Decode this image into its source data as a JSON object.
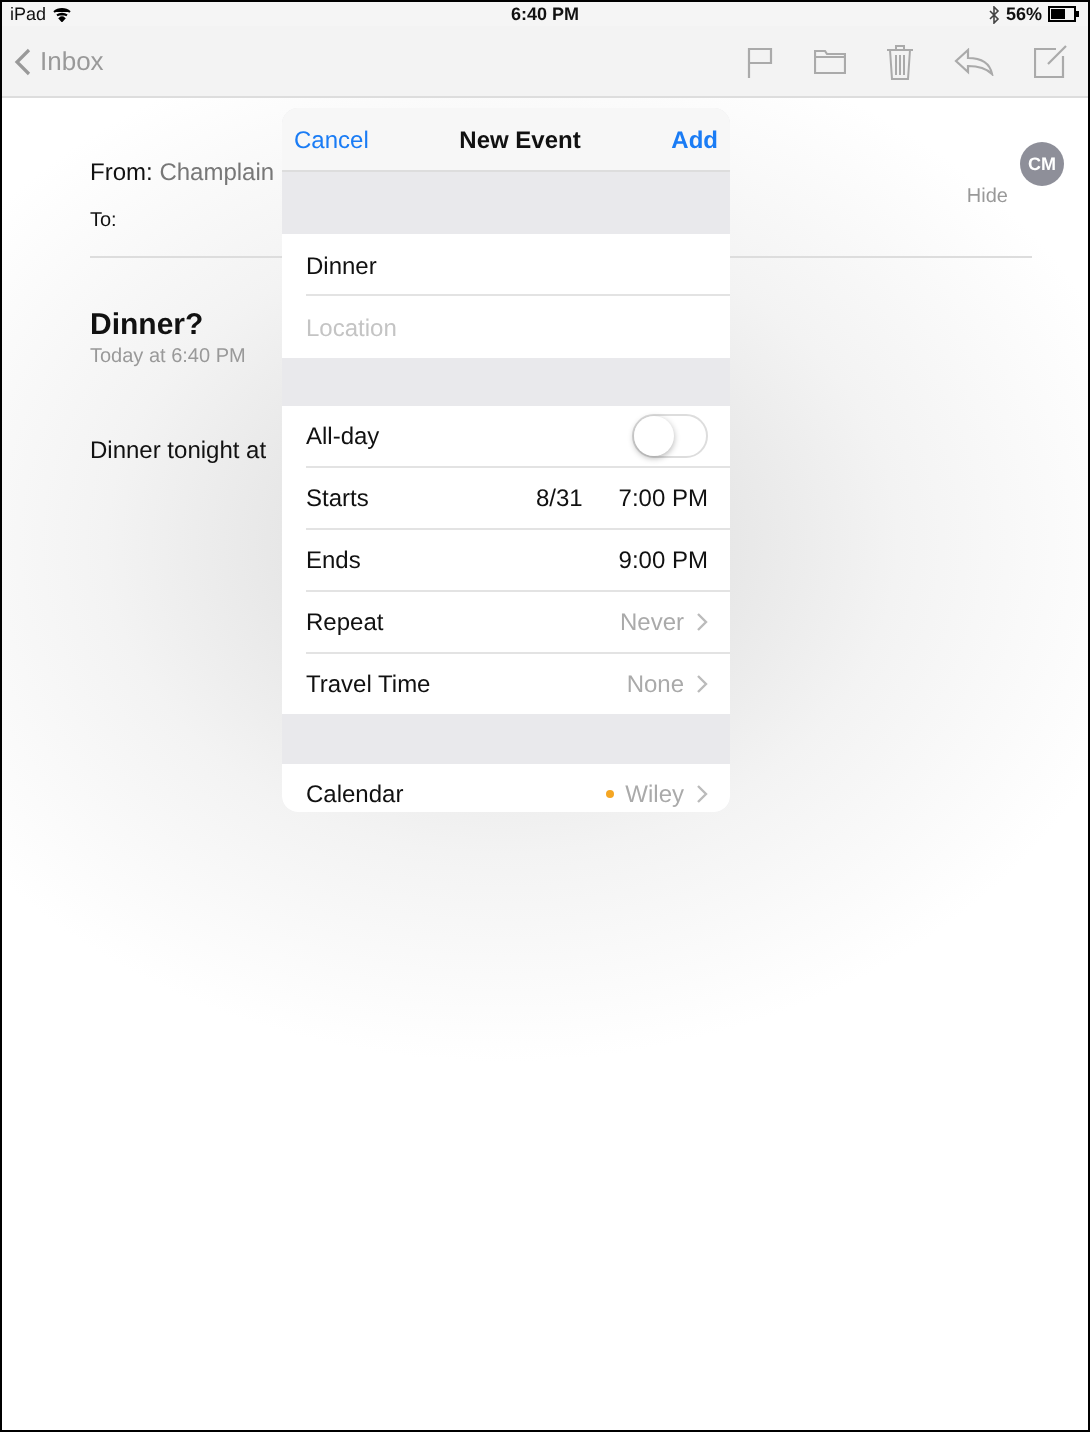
{
  "status_bar": {
    "device": "iPad",
    "time": "6:40 PM",
    "battery": "56%"
  },
  "nav_bar": {
    "back": "Inbox"
  },
  "message": {
    "from_label": "From:",
    "from": "Champlain",
    "to_label": "To:",
    "hide": "Hide",
    "avatar": "CM",
    "subject": "Dinner?",
    "date": "Today at 6:40 PM",
    "body": "Dinner tonight at"
  },
  "popover": {
    "cancel": "Cancel",
    "title": "New Event",
    "add": "Add",
    "title_field": {
      "value": "Dinner"
    },
    "location_field": {
      "placeholder": "Location"
    },
    "rows": [
      {
        "kind": "toggle",
        "label": "All-day",
        "on": false
      },
      {
        "kind": "value",
        "label": "Starts",
        "date": "8/31",
        "value": "7:00 PM"
      },
      {
        "kind": "value",
        "label": "Ends",
        "value": "9:00 PM"
      },
      {
        "kind": "link",
        "label": "Repeat",
        "value": "Never"
      },
      {
        "kind": "link",
        "label": "Travel Time",
        "value": "None"
      },
      {
        "kind": "gap"
      },
      {
        "kind": "calendar",
        "label": "Calendar",
        "value": "Wiley",
        "color": "#f5a623"
      }
    ]
  }
}
